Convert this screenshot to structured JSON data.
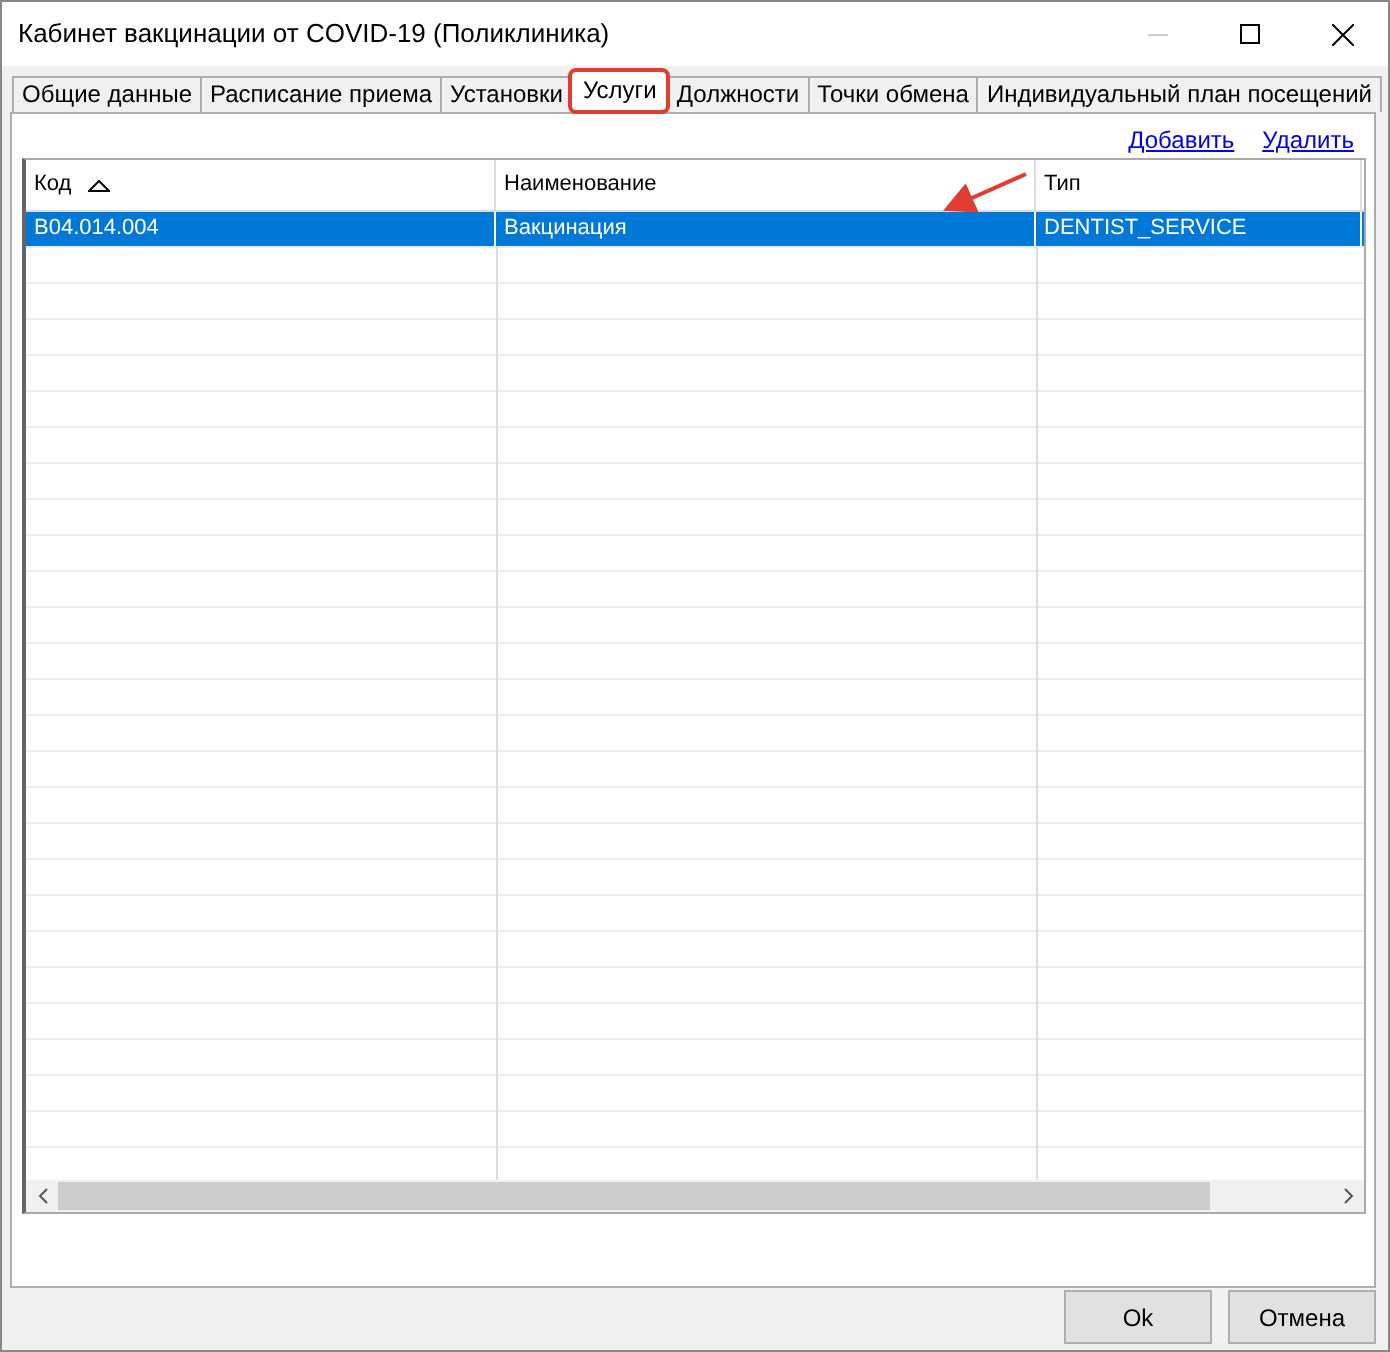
{
  "window": {
    "title": "Кабинет вакцинации от COVID-19 (Поликлиника)"
  },
  "tabs": [
    {
      "label": "Общие данные",
      "selected": false,
      "highlighted": false
    },
    {
      "label": "Расписание приема",
      "selected": false,
      "highlighted": false
    },
    {
      "label": "Установки",
      "selected": false,
      "highlighted": false
    },
    {
      "label": "Услуги",
      "selected": true,
      "highlighted": true
    },
    {
      "label": "Должности",
      "selected": false,
      "highlighted": false
    },
    {
      "label": "Точки обмена",
      "selected": false,
      "highlighted": false
    },
    {
      "label": "Индивидуальный план посещений",
      "selected": false,
      "highlighted": false
    }
  ],
  "links": [
    "Добавить",
    "Удалить"
  ],
  "table": {
    "columns": [
      {
        "label": "Код",
        "sorted": true
      },
      {
        "label": "Наименование",
        "sorted": false
      },
      {
        "label": "Тип",
        "sorted": false
      }
    ],
    "rows": [
      {
        "cells": [
          "B04.014.004",
          "Вакцинация",
          "DENTIST_SERVICE"
        ],
        "selected": true
      }
    ]
  },
  "buttons": [
    "Ok",
    "Отмена"
  ]
}
